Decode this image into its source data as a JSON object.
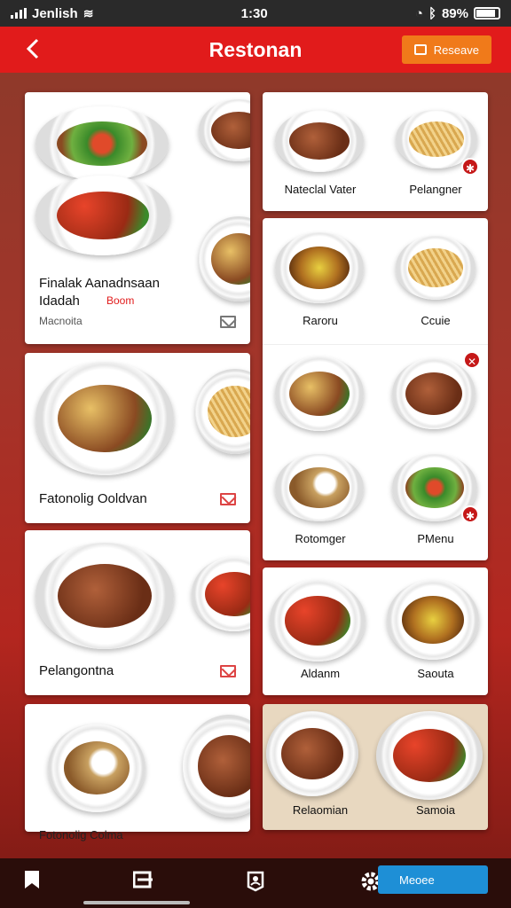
{
  "status_bar": {
    "carrier": "Jenlish",
    "time": "1:30",
    "battery": "89%"
  },
  "header": {
    "title": "Restonan",
    "back_icon": "chevron-left-icon",
    "reserve_label": "Reseave"
  },
  "left_cards": [
    {
      "title": "Finalak Aanadnsaan Idadah",
      "highlight": "Boom",
      "meta": "Macnoita"
    },
    {
      "title": "Fatonolig Ooldvan"
    },
    {
      "title": "Pelangontna"
    },
    {
      "title": "Fotonolig Colma"
    }
  ],
  "right_cards": [
    {
      "captions": [
        "Nateclal Vater",
        "Pelangner"
      ]
    },
    {
      "captions": [
        "Raroru",
        "Ccuie",
        "Rotomger",
        "PMenu"
      ]
    },
    {
      "captions": [
        "Aldanm",
        "Saouta"
      ]
    },
    {
      "captions": [
        "Relaomian",
        "Samoia"
      ]
    }
  ],
  "bottom_nav": {
    "pill_label": "Meoee",
    "icons": [
      "bookmark-icon",
      "menu-icon",
      "user-icon",
      "gear-icon"
    ]
  },
  "colors": {
    "header_red": "#e11b1b",
    "reserve_orange": "#f07a1a",
    "pill_blue": "#1e8fd6"
  }
}
